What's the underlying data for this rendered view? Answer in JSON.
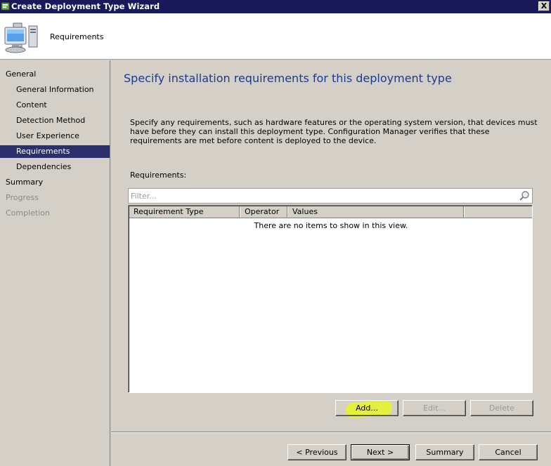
{
  "window": {
    "title": "Create Deployment Type Wizard",
    "close_label": "X"
  },
  "header": {
    "step_title": "Requirements",
    "icon": "computer-icon"
  },
  "nav": {
    "items": [
      {
        "label": "General",
        "level": "top",
        "state": "normal"
      },
      {
        "label": "General Information",
        "level": "sub",
        "state": "normal"
      },
      {
        "label": "Content",
        "level": "sub",
        "state": "normal"
      },
      {
        "label": "Detection Method",
        "level": "sub",
        "state": "normal"
      },
      {
        "label": "User Experience",
        "level": "sub",
        "state": "normal"
      },
      {
        "label": "Requirements",
        "level": "sub",
        "state": "selected"
      },
      {
        "label": "Dependencies",
        "level": "sub",
        "state": "normal"
      },
      {
        "label": "Summary",
        "level": "top",
        "state": "normal"
      },
      {
        "label": "Progress",
        "level": "top",
        "state": "disabled"
      },
      {
        "label": "Completion",
        "level": "top",
        "state": "disabled"
      }
    ]
  },
  "main": {
    "heading": "Specify installation requirements for this deployment type",
    "description": "Specify any requirements, such as hardware features or the operating system version, that devices must have before they can install this deployment type. Configuration Manager verifies that these requirements are met before content is deployed to the device.",
    "requirements_label": "Requirements:",
    "filter_placeholder": "Filter...",
    "columns": [
      "Requirement Type",
      "Operator",
      "Values"
    ],
    "empty_message": "There are no items to show in this view.",
    "buttons": {
      "add": "Add...",
      "edit": "Edit...",
      "delete": "Delete"
    }
  },
  "footer": {
    "previous": "< Previous",
    "next": "Next >",
    "summary": "Summary",
    "cancel": "Cancel"
  },
  "colors": {
    "titlebar": "#1a1a5a",
    "selection": "#2b2f6b",
    "heading": "#1f3a8a",
    "highlight": "#e8f528"
  }
}
